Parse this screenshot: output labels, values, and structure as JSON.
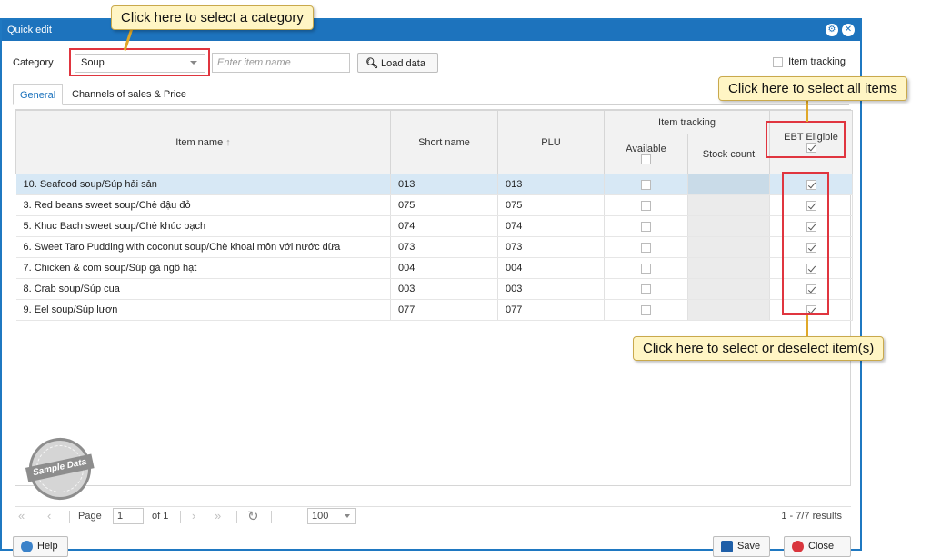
{
  "dialog": {
    "title": "Quick edit"
  },
  "toolbar": {
    "category_label": "Category",
    "category_value": "Soup",
    "item_name_placeholder": "Enter item name",
    "load_label": "Load data",
    "item_tracking_label": "Item tracking"
  },
  "tabs": [
    "General",
    "Channels of sales & Price"
  ],
  "table": {
    "headers": {
      "item_name": "Item name",
      "sort_icon": "↑",
      "short_name": "Short name",
      "plu": "PLU",
      "item_tracking": "Item tracking",
      "available": "Available",
      "stock_count": "Stock count",
      "ebt": "EBT Eligible"
    },
    "rows": [
      {
        "name": "10. Seafood soup/Súp hải sản",
        "short": "013",
        "plu": "013",
        "available": false,
        "ebt": true
      },
      {
        "name": "3. Red beans sweet soup/Chè đậu đỏ",
        "short": "075",
        "plu": "075",
        "available": false,
        "ebt": true
      },
      {
        "name": "5. Khuc Bach sweet soup/Chè khúc bạch",
        "short": "074",
        "plu": "074",
        "available": false,
        "ebt": true
      },
      {
        "name": "6. Sweet Taro Pudding with coconut soup/Chè khoai môn với nước dừa",
        "short": "073",
        "plu": "073",
        "available": false,
        "ebt": true
      },
      {
        "name": "7. Chicken & com soup/Súp gà ngô hạt",
        "short": "004",
        "plu": "004",
        "available": false,
        "ebt": true
      },
      {
        "name": "8. Crab soup/Súp cua",
        "short": "003",
        "plu": "003",
        "available": false,
        "ebt": true
      },
      {
        "name": "9. Eel soup/Súp lươn",
        "short": "077",
        "plu": "077",
        "available": false,
        "ebt": true
      }
    ]
  },
  "stamp": "Sample Data",
  "pager": {
    "page_label": "Page",
    "page_value": "1",
    "of_label": "of 1",
    "page_size": "100",
    "results": "1 - 7/7 results"
  },
  "footer": {
    "help_label": "Help",
    "save_label": "Save",
    "close_label": "Close"
  },
  "callouts": {
    "category": "Click here to select a category",
    "select_all": "Click here to select all items",
    "select_items": "Click here to select or deselect item(s)"
  },
  "colors": {
    "title_bar": "#1d73bd",
    "highlight_box": "#e0353f",
    "callout_bg": "#fff5c4",
    "selected_row": "#d7e8f5"
  }
}
